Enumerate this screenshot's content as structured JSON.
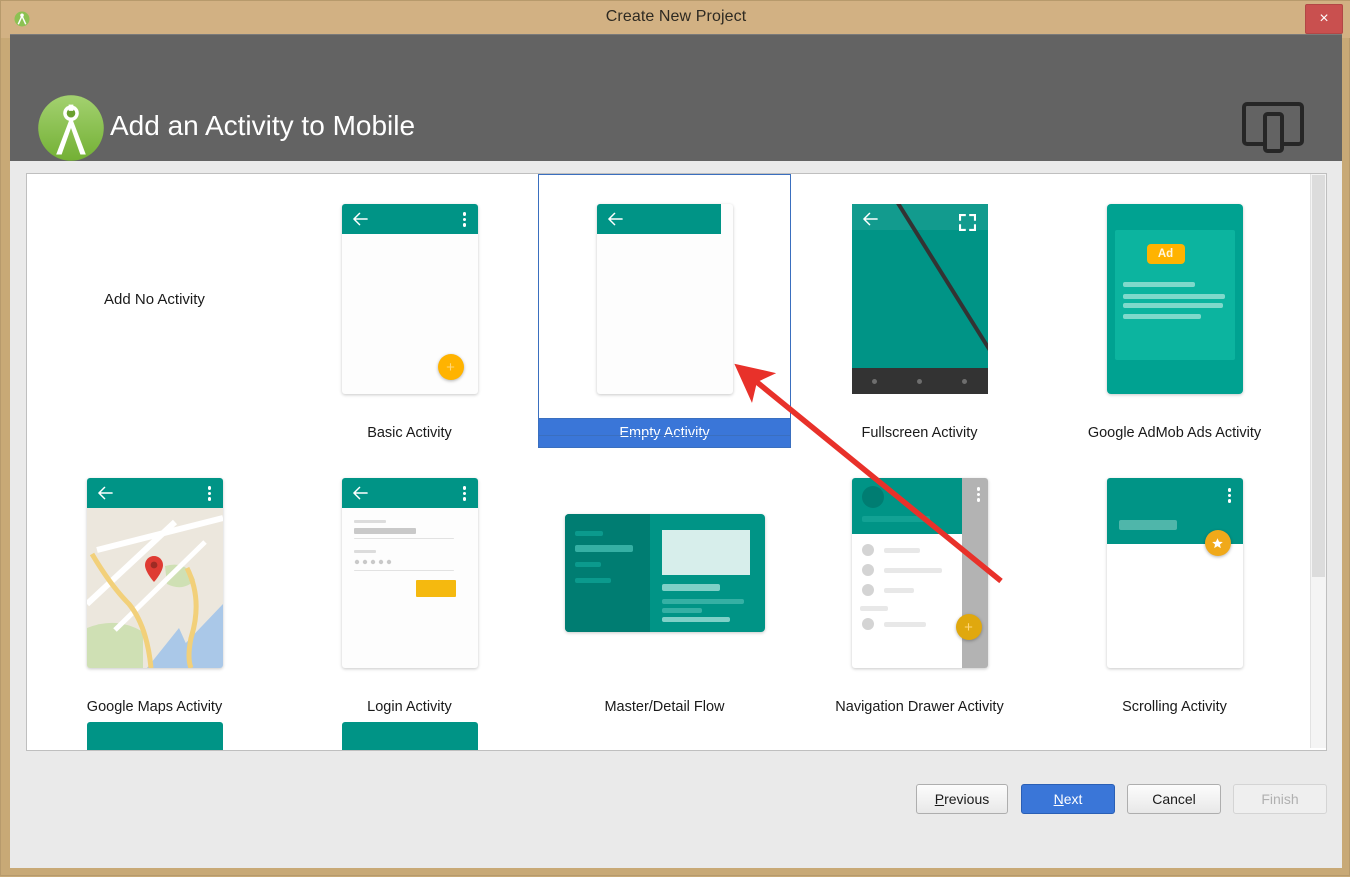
{
  "window": {
    "title": "Create New Project",
    "close_label": "×",
    "app_icon": "android-studio-icon"
  },
  "header": {
    "title": "Add an Activity to Mobile",
    "logo_icon": "android-studio-logo",
    "device_icon": "mobile-device-icon",
    "colors": {
      "band": "#636363",
      "titlebar": "#d2b183",
      "accent_teal": "#009486",
      "accent_yellow": "#ffb300",
      "selection_blue": "#3a76d8"
    }
  },
  "templates": {
    "rows": [
      [
        {
          "name": "Add No Activity",
          "thumb": "none"
        },
        {
          "name": "Basic Activity",
          "thumb": "basic"
        },
        {
          "name": "Empty Activity",
          "thumb": "empty",
          "selected": true
        },
        {
          "name": "Fullscreen Activity",
          "thumb": "fullscreen"
        },
        {
          "name": "Google AdMob Ads Activity",
          "thumb": "admob",
          "badge": "Ad"
        }
      ],
      [
        {
          "name": "Google Maps Activity",
          "thumb": "maps"
        },
        {
          "name": "Login Activity",
          "thumb": "login"
        },
        {
          "name": "Master/Detail Flow",
          "thumb": "masterdetail"
        },
        {
          "name": "Navigation Drawer Activity",
          "thumb": "navdrawer"
        },
        {
          "name": "Scrolling Activity",
          "thumb": "scrolling"
        }
      ]
    ]
  },
  "footer": {
    "buttons": [
      {
        "id": "previous",
        "label": "Previous",
        "mnemonic": "P",
        "state": "enabled"
      },
      {
        "id": "next",
        "label": "Next",
        "mnemonic": "N",
        "state": "default"
      },
      {
        "id": "cancel",
        "label": "Cancel",
        "mnemonic": "",
        "state": "enabled"
      },
      {
        "id": "finish",
        "label": "Finish",
        "mnemonic": "",
        "state": "disabled"
      }
    ]
  },
  "annotation": {
    "type": "arrow",
    "color": "#e8312a",
    "points_to": "Empty Activity"
  }
}
